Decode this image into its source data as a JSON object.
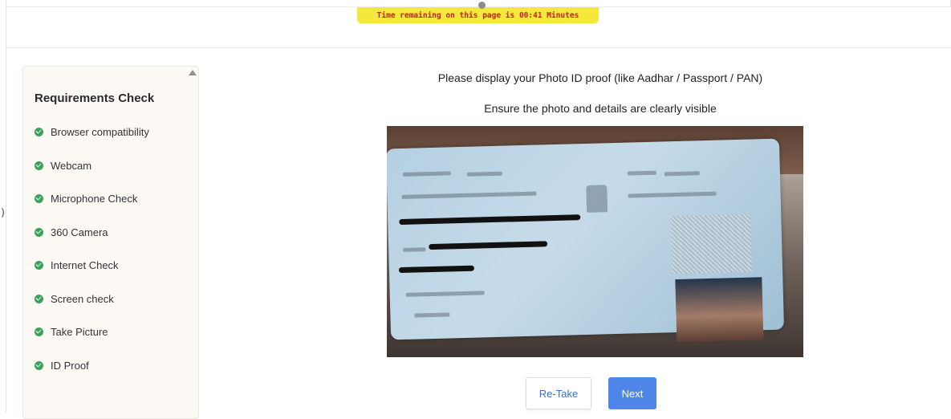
{
  "header": {
    "timer_text": "Time remaining on this page is 00:41 Minutes"
  },
  "sidebar": {
    "title": "Requirements Check",
    "items": [
      {
        "label": "Browser compatibility",
        "status": "passed",
        "icon": "check-circle-icon"
      },
      {
        "label": "Webcam",
        "status": "passed",
        "icon": "check-circle-icon"
      },
      {
        "label": "Microphone Check",
        "status": "passed",
        "icon": "check-circle-icon"
      },
      {
        "label": "360 Camera",
        "status": "passed",
        "icon": "check-circle-icon"
      },
      {
        "label": "Internet Check",
        "status": "passed",
        "icon": "check-circle-icon"
      },
      {
        "label": "Screen check",
        "status": "passed",
        "icon": "check-circle-icon"
      },
      {
        "label": "Take Picture",
        "status": "passed",
        "icon": "check-circle-icon"
      },
      {
        "label": "ID Proof",
        "status": "passed",
        "icon": "check-circle-icon"
      }
    ]
  },
  "main": {
    "instruction_1": "Please display your Photo ID proof (like Aadhar / Passport / PAN)",
    "instruction_2": "Ensure the photo and details are clearly visible",
    "buttons": {
      "retake": "Re-Take",
      "next": "Next"
    }
  },
  "colors": {
    "timer_bg": "#f4e83a",
    "timer_text": "#c81f1f",
    "check_green": "#3aa35b",
    "primary_button": "#4e86ea",
    "sidebar_bg": "#fdfaf6"
  }
}
